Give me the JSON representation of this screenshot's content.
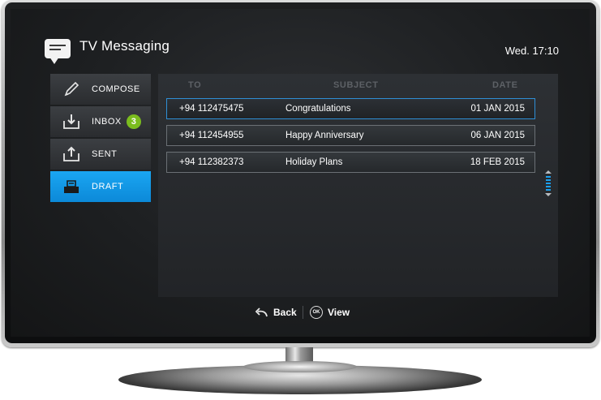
{
  "app": {
    "title": "TV Messaging",
    "clock": "Wed. 17:10"
  },
  "sidebar": {
    "items": [
      {
        "label": "COMPOSE",
        "icon": "pencil-icon",
        "active": false
      },
      {
        "label": "INBOX",
        "icon": "inbox-download-icon",
        "badge": "3",
        "active": false
      },
      {
        "label": "SENT",
        "icon": "outbox-upload-icon",
        "active": false
      },
      {
        "label": "DRAFT",
        "icon": "draft-tray-icon",
        "active": true
      }
    ],
    "active_color": "#1aa6f2",
    "badge_color": "#7bbd1e"
  },
  "table": {
    "columns": [
      "TO",
      "SUBJECT",
      "DATE"
    ],
    "rows": [
      {
        "to": "+94 112475475",
        "subject": "Congratulations",
        "date": "01 JAN 2015",
        "selected": true
      },
      {
        "to": "+94 112454955",
        "subject": "Happy Anniversary",
        "date": "06 JAN 2015",
        "selected": false
      },
      {
        "to": "+94 112382373",
        "subject": "Holiday Plans",
        "date": "18 FEB 2015",
        "selected": false
      }
    ],
    "selection_color": "#2f8fd6"
  },
  "footer": {
    "back_label": "Back",
    "back_icon": "return-arrow-icon",
    "ok_symbol": "OK",
    "view_label": "View"
  }
}
